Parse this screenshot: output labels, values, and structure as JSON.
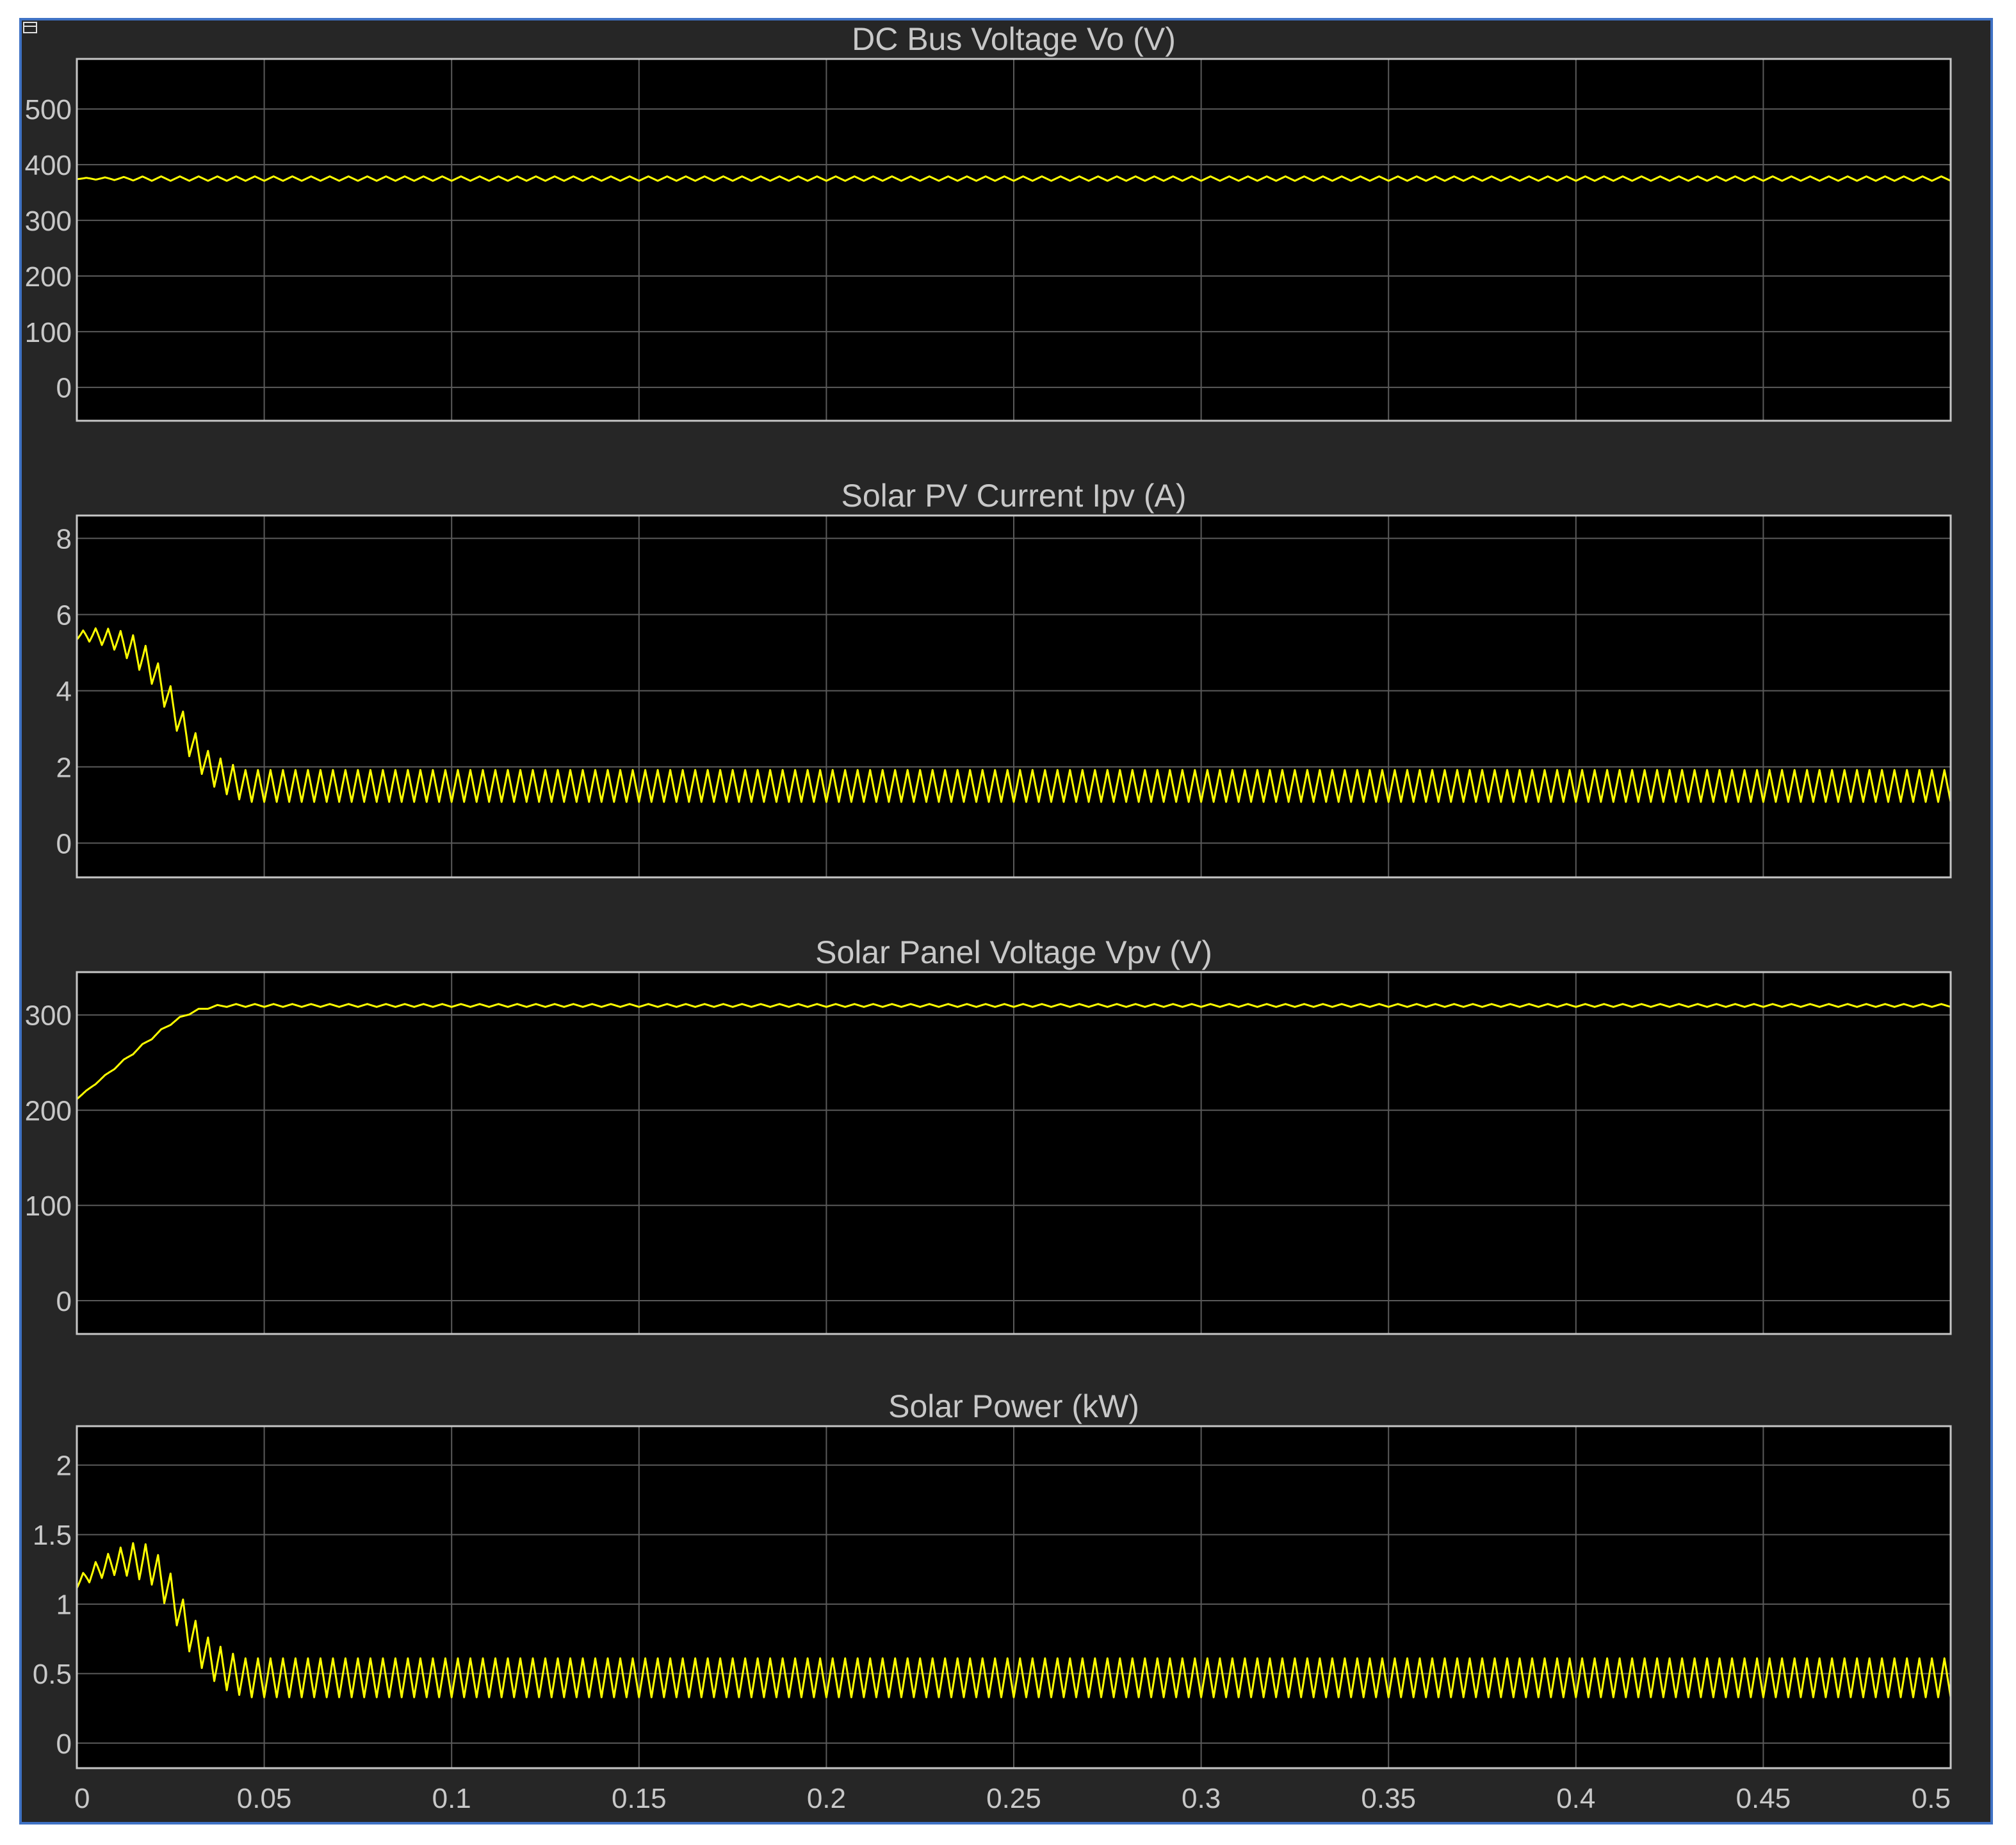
{
  "colors": {
    "frame_border": "#3f72c4",
    "figure_background": "#262626",
    "axes_background": "#000000",
    "grid": "#5a5a5a",
    "axes_border": "#c6c6c6",
    "text": "#c8c8c8",
    "trace": "#ffff00"
  },
  "icons": {
    "corner": "dock-icon"
  },
  "chart_data": [
    {
      "type": "line",
      "title": "DC Bus Voltage Vo (V)",
      "xlim": [
        0,
        0.5
      ],
      "ylim": [
        -60,
        590
      ],
      "yticks": [
        0,
        100,
        200,
        300,
        400,
        500
      ],
      "ytick_labels": [
        "0",
        "100",
        "200",
        "300",
        "400",
        "500"
      ],
      "grid": true,
      "series": [
        {
          "x": [
            0,
            0,
            0.0005,
            0.5
          ],
          "y": [
            0,
            375,
            375,
            375
          ],
          "ripple": 4,
          "ripple_cycles": 100
        }
      ]
    },
    {
      "type": "line",
      "title": "Solar PV Current Ipv (A)",
      "xlim": [
        0,
        0.5
      ],
      "ylim": [
        -0.9,
        8.6
      ],
      "yticks": [
        0,
        2,
        4,
        6,
        8
      ],
      "ytick_labels": [
        "0",
        "2",
        "4",
        "6",
        "8"
      ],
      "grid": true,
      "series": [
        {
          "x": [
            0,
            0,
            0.005,
            0.01,
            0.015,
            0.02,
            0.025,
            0.03,
            0.035,
            0.04,
            0.045,
            0.5
          ],
          "y": [
            0,
            5.45,
            5.45,
            5.35,
            5.1,
            4.6,
            3.7,
            2.7,
            2.0,
            1.7,
            1.5,
            1.5
          ],
          "ripple": 0.42,
          "ripple_cycles": 150
        }
      ]
    },
    {
      "type": "line",
      "title": "Solar Panel Voltage Vpv (V)",
      "xlim": [
        0,
        0.5
      ],
      "ylim": [
        -35,
        345
      ],
      "yticks": [
        0,
        100,
        200,
        300
      ],
      "ytick_labels": [
        "0",
        "100",
        "200",
        "300"
      ],
      "grid": true,
      "series": [
        {
          "x": [
            0,
            0,
            0.005,
            0.01,
            0.015,
            0.02,
            0.025,
            0.03,
            0.035,
            0.04,
            0.045,
            0.5
          ],
          "y": [
            0,
            212,
            228,
            244,
            260,
            276,
            291,
            302,
            308,
            310,
            310,
            310
          ],
          "ripple": 1.5,
          "ripple_cycles": 100
        }
      ]
    },
    {
      "type": "line",
      "title": "Solar Power (kW)",
      "xlim": [
        0,
        0.5
      ],
      "ylim": [
        -0.18,
        2.28
      ],
      "yticks": [
        0,
        0.5,
        1,
        1.5,
        2
      ],
      "ytick_labels": [
        "0",
        "0.5",
        "1",
        "1.5",
        "2"
      ],
      "xticks": [
        0,
        0.05,
        0.1,
        0.15,
        0.2,
        0.25,
        0.3,
        0.35,
        0.4,
        0.45,
        0.5
      ],
      "xtick_labels": [
        "0",
        "0.05",
        "0.1",
        "0.15",
        "0.2",
        "0.25",
        "0.3",
        "0.35",
        "0.4",
        "0.45",
        "0.5"
      ],
      "grid": true,
      "series": [
        {
          "x": [
            0,
            0,
            0.005,
            0.01,
            0.015,
            0.02,
            0.025,
            0.03,
            0.035,
            0.04,
            0.045,
            0.5
          ],
          "y": [
            0,
            1.15,
            1.24,
            1.3,
            1.32,
            1.28,
            1.08,
            0.8,
            0.62,
            0.52,
            0.47,
            0.47
          ],
          "ripple": 0.14,
          "ripple_cycles": 150
        }
      ]
    }
  ]
}
